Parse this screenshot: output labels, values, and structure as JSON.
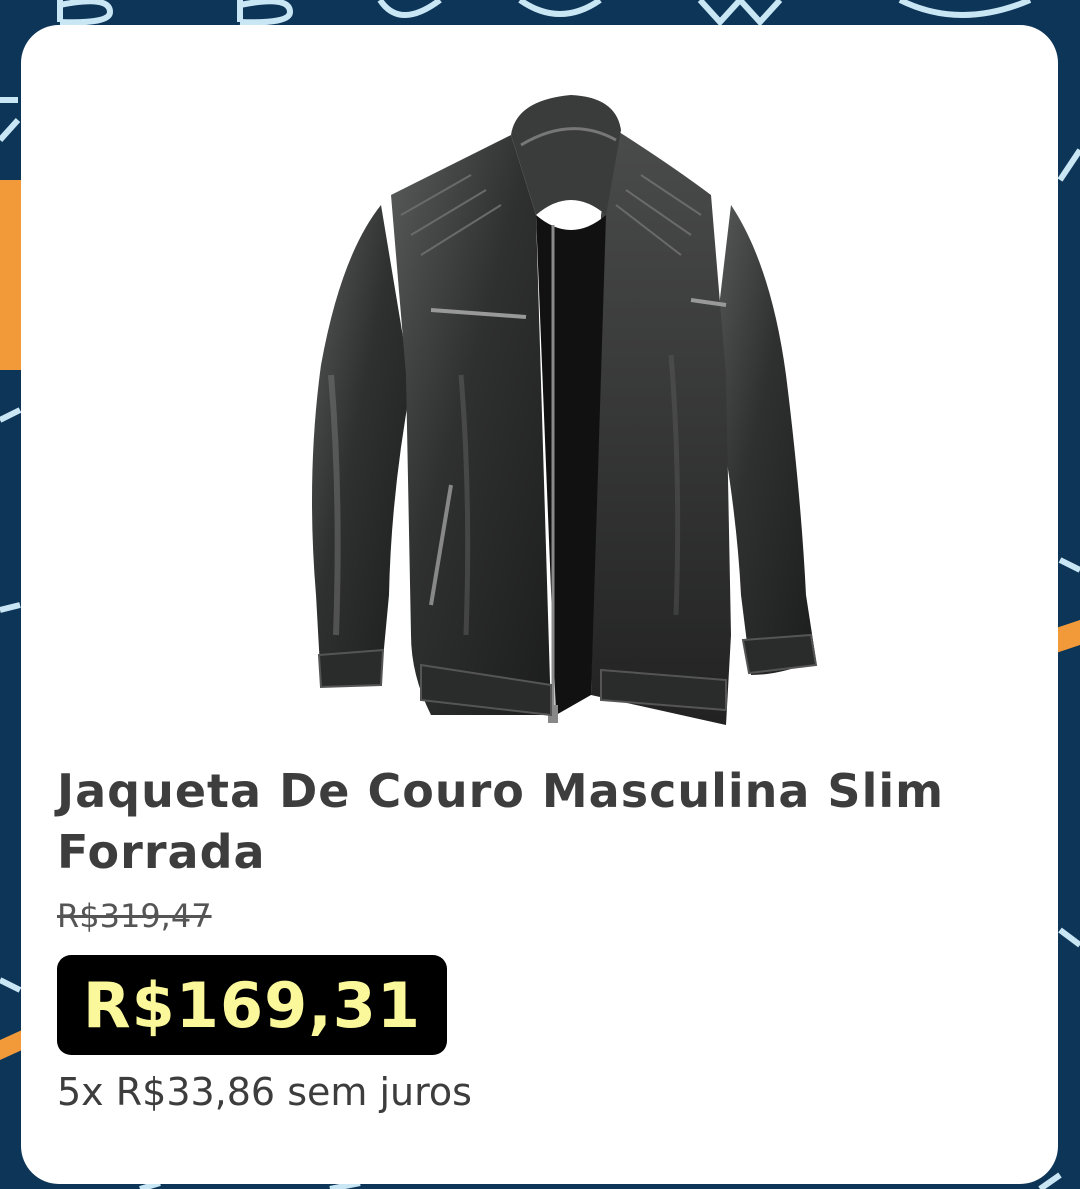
{
  "product": {
    "image_label": "leather-jacket-photo",
    "title": "Jaqueta De Couro Masculina Slim Forrada",
    "old_price": "R$319,47",
    "price": "R$169,31",
    "installments": "5x R$33,86 sem juros"
  },
  "colors": {
    "background": "#0d3558",
    "accent_orange": "#f29a3a",
    "accent_light_blue": "#c9e6f5",
    "price_bg": "#000000",
    "price_text": "#fbf79b",
    "text": "#3d3d3d"
  }
}
